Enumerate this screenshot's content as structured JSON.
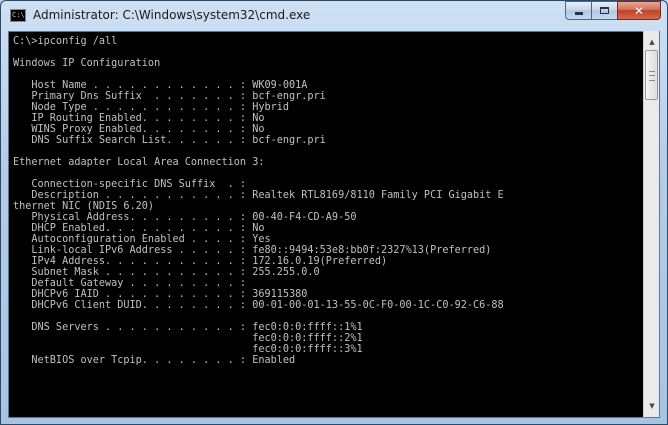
{
  "window": {
    "title": "Administrator: C:\\Windows\\system32\\cmd.exe",
    "app_icon_glyph": "C:\\",
    "controls": {
      "minimize": "minimize-icon",
      "maximize": "maximize-icon",
      "close_glyph": "✕"
    }
  },
  "console": {
    "colors": {
      "background": "#000000",
      "text": "#c0c0c0"
    },
    "lines": [
      "C:\\>ipconfig /all",
      "",
      "Windows IP Configuration",
      "",
      "   Host Name . . . . . . . . . . . . : WK09-001A",
      "   Primary Dns Suffix  . . . . . . . : bcf-engr.pri",
      "   Node Type . . . . . . . . . . . . : Hybrid",
      "   IP Routing Enabled. . . . . . . . : No",
      "   WINS Proxy Enabled. . . . . . . . : No",
      "   DNS Suffix Search List. . . . . . : bcf-engr.pri",
      "",
      "Ethernet adapter Local Area Connection 3:",
      "",
      "   Connection-specific DNS Suffix  . :",
      "   Description . . . . . . . . . . . : Realtek RTL8169/8110 Family PCI Gigabit E",
      "thernet NIC (NDIS 6.20)",
      "   Physical Address. . . . . . . . . : 00-40-F4-CD-A9-50",
      "   DHCP Enabled. . . . . . . . . . . : No",
      "   Autoconfiguration Enabled . . . . : Yes",
      "   Link-local IPv6 Address . . . . . : fe80::9494:53e8:bb0f:2327%13(Preferred)",
      "   IPv4 Address. . . . . . . . . . . : 172.16.0.19(Preferred)",
      "   Subnet Mask . . . . . . . . . . . : 255.255.0.0",
      "   Default Gateway . . . . . . . . . :",
      "   DHCPv6 IAID . . . . . . . . . . . : 369115380",
      "   DHCPv6 Client DUID. . . . . . . . : 00-01-00-01-13-55-0C-F0-00-1C-C0-92-C6-88",
      "",
      "   DNS Servers . . . . . . . . . . . : fec0:0:0:ffff::1%1",
      "                                       fec0:0:0:ffff::2%1",
      "                                       fec0:0:0:ffff::3%1",
      "   NetBIOS over Tcpip. . . . . . . . : Enabled"
    ]
  },
  "scrollbar": {
    "up_icon": "▲",
    "down_icon": "▼"
  }
}
